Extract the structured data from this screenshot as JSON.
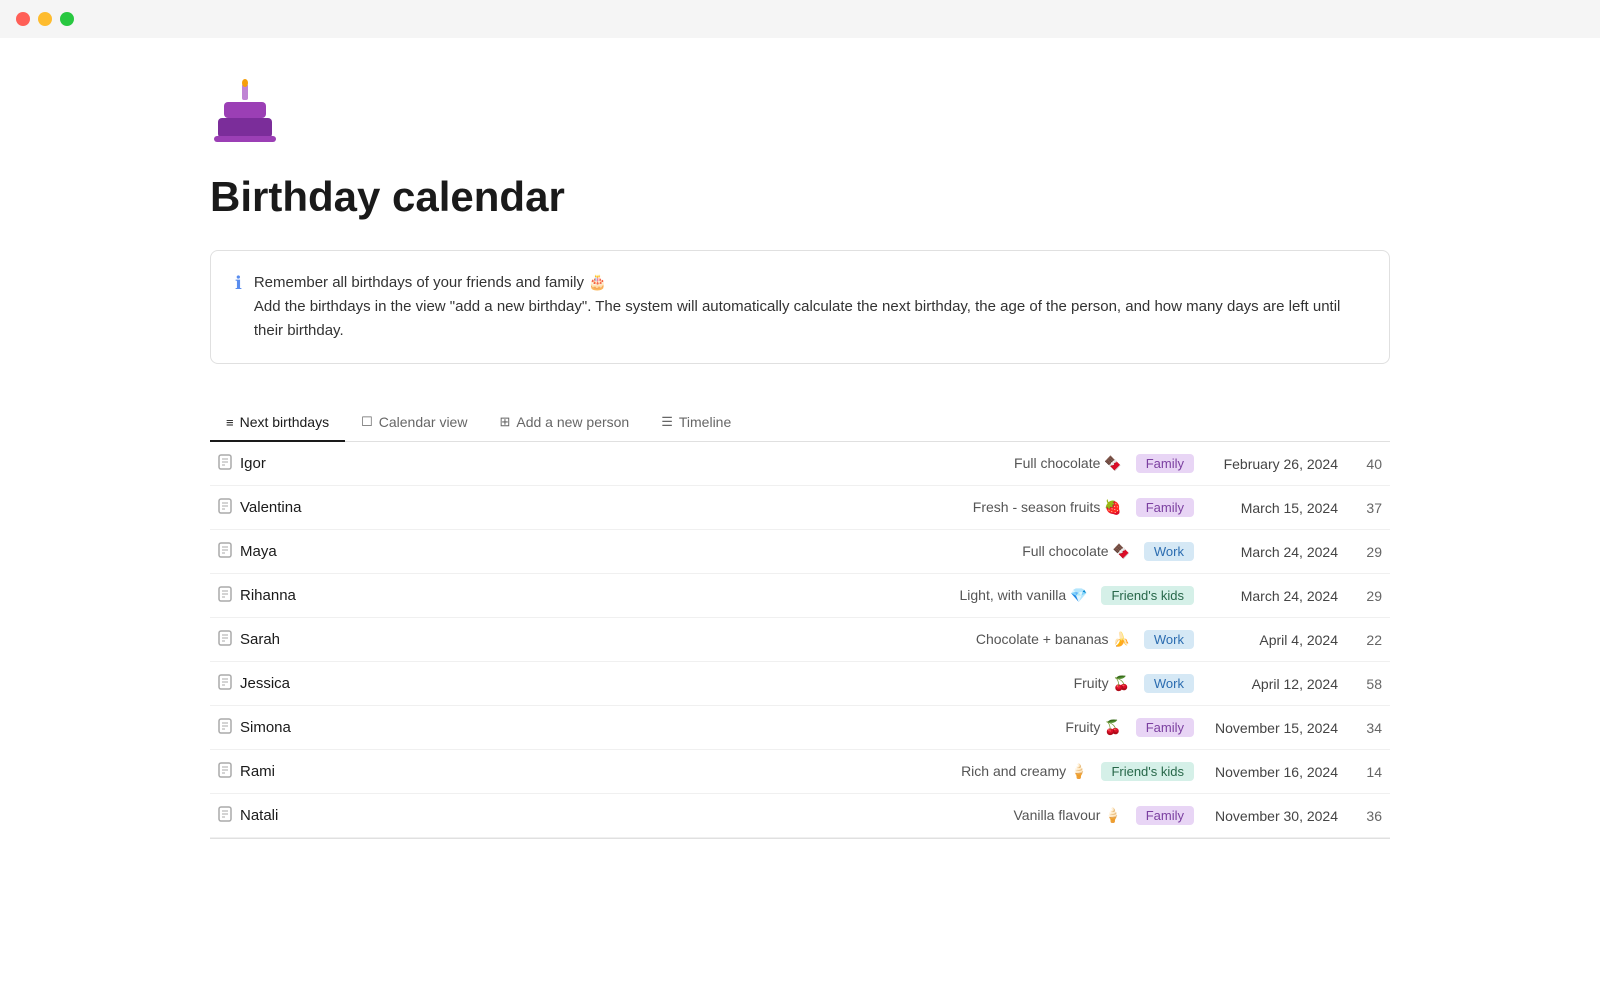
{
  "titlebar": {
    "traffic_lights": [
      "red",
      "yellow",
      "green"
    ]
  },
  "page": {
    "title": "Birthday calendar",
    "cake_emoji": "🎂",
    "info_line1": "Remember all birthdays of your friends and family 🎂",
    "info_line2": "Add the birthdays in the view \"add a new birthday\". The system will automatically calculate the next birthday, the age of the person, and how many days are left until their birthday."
  },
  "tabs": [
    {
      "id": "next-birthdays",
      "icon": "≡",
      "label": "Next birthdays",
      "active": true
    },
    {
      "id": "calendar-view",
      "icon": "☐",
      "label": "Calendar view",
      "active": false
    },
    {
      "id": "add-person",
      "icon": "⊞",
      "label": "Add a new person",
      "active": false
    },
    {
      "id": "timeline",
      "icon": "☰",
      "label": "Timeline",
      "active": false
    }
  ],
  "people": [
    {
      "name": "Igor",
      "flavor": "Full chocolate 🍫",
      "tag": "Family",
      "tag_type": "family",
      "date": "February 26, 2024",
      "age": "40"
    },
    {
      "name": "Valentina",
      "flavor": "Fresh - season fruits 🍓",
      "tag": "Family",
      "tag_type": "family",
      "date": "March 15, 2024",
      "age": "37"
    },
    {
      "name": "Maya",
      "flavor": "Full chocolate 🍫",
      "tag": "Work",
      "tag_type": "work",
      "date": "March 24, 2024",
      "age": "29"
    },
    {
      "name": "Rihanna",
      "flavor": "Light, with vanilla 💎",
      "tag": "Friend's kids",
      "tag_type": "friends-kids",
      "date": "March 24, 2024",
      "age": "29"
    },
    {
      "name": "Sarah",
      "flavor": "Chocolate + bananas 🍌",
      "tag": "Work",
      "tag_type": "work",
      "date": "April 4, 2024",
      "age": "22"
    },
    {
      "name": "Jessica",
      "flavor": "Fruity 🍒",
      "tag": "Work",
      "tag_type": "work",
      "date": "April 12, 2024",
      "age": "58"
    },
    {
      "name": "Simona",
      "flavor": "Fruity 🍒",
      "tag": "Family",
      "tag_type": "family",
      "date": "November 15, 2024",
      "age": "34"
    },
    {
      "name": "Rami",
      "flavor": "Rich and creamy 🍦",
      "tag": "Friend's kids",
      "tag_type": "friends-kids",
      "date": "November 16, 2024",
      "age": "14"
    },
    {
      "name": "Natali",
      "flavor": "Vanilla flavour 🍦",
      "tag": "Family",
      "tag_type": "family",
      "date": "November 30, 2024",
      "age": "36"
    }
  ]
}
